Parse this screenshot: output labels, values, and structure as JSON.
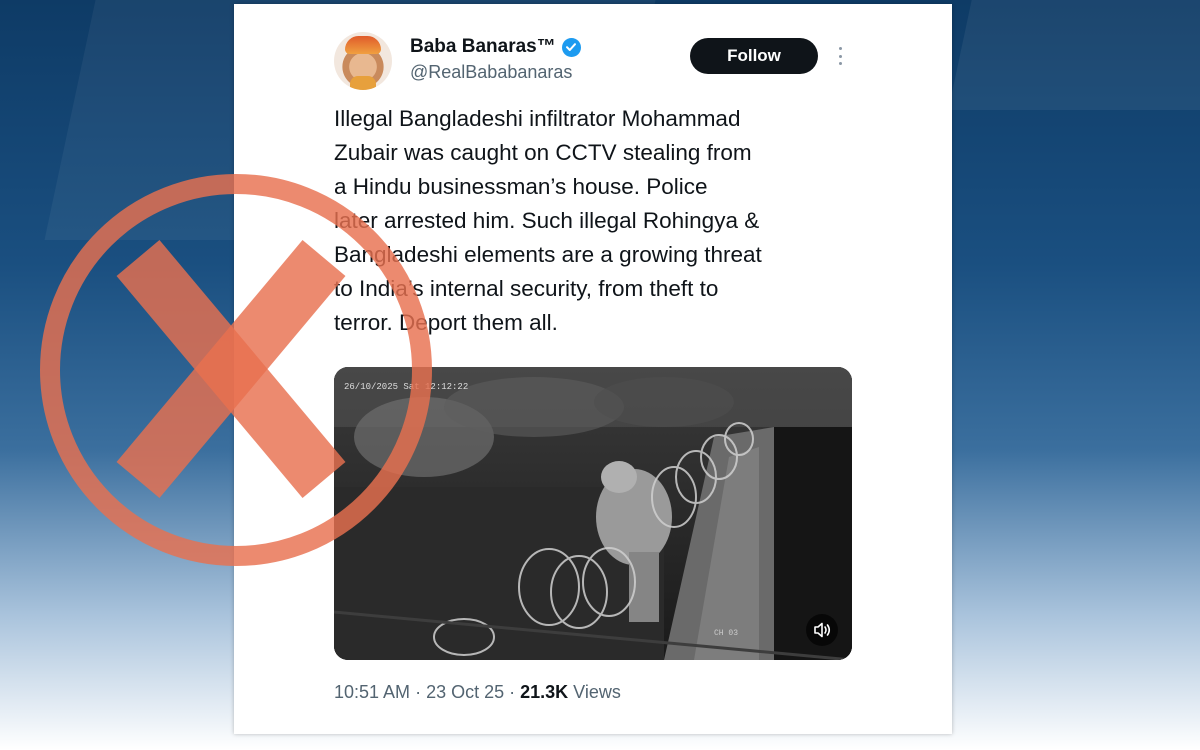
{
  "tweet": {
    "display_name": "Baba Banaras™",
    "handle": "@RealBababanaras",
    "follow_label": "Follow",
    "text_lines": [
      "Illegal Bangladeshi infiltrator Mohammad",
      "Zubair was caught on CCTV stealing from",
      "a Hindu businessman’s house. Police",
      "later arrested him. Such illegal Rohingya &",
      "Bangladeshi elements are a growing threat",
      "to India’s internal security,  from theft to",
      "terror. Deport them all."
    ],
    "time": "10:51 AM",
    "date": "23 Oct 25",
    "views_count": "21.3K",
    "views_label": "Views",
    "separator": " · "
  },
  "media": {
    "cctv_timestamp": "26/10/2025 Sat 12:12:22",
    "cctv_channel": "CH 03"
  },
  "icons": {
    "verified": "verified-badge-icon",
    "more": "more-options-icon",
    "volume": "volume-icon",
    "overlay": "red-x-in-circle-icon"
  },
  "colors": {
    "verified_blue": "#1d9bf0",
    "follow_bg": "#0f1419",
    "overlay_mark": "#e8704f"
  }
}
